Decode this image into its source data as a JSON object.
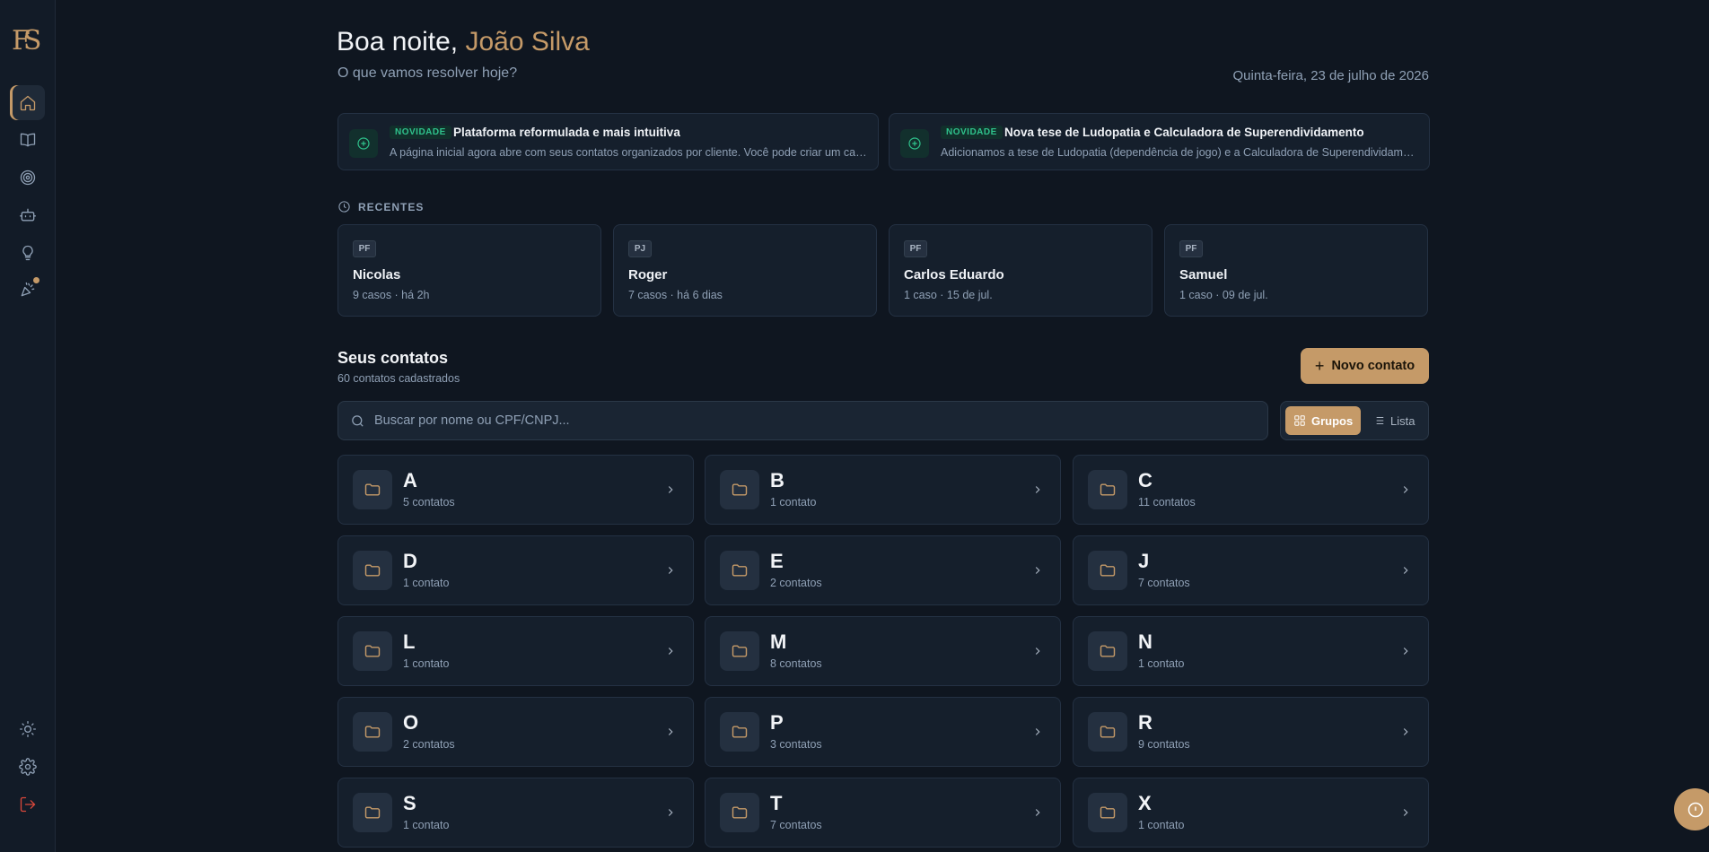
{
  "greeting": {
    "prefix": "Boa noite,",
    "name": "João Silva"
  },
  "subtitle": "O que vamos resolver hoje?",
  "date": "Quinta-feira, 23 de julho de 2026",
  "news": [
    {
      "badge": "NOVIDADE",
      "title": "Plataforma reformulada e mais intuitiva",
      "description": "A página inicial agora abre com seus contatos organizados por cliente. Você pode criar um caso..."
    },
    {
      "badge": "NOVIDADE",
      "title": "Nova tese de Ludopatia e Calculadora de Superendividamento",
      "description": "Adicionamos a tese de Ludopatia (dependência de jogo) e a Calculadora de Superendividamento..."
    }
  ],
  "recents": {
    "label": "RECENTES",
    "items": [
      {
        "type": "PF",
        "name": "Nicolas",
        "meta": "9 casos · há 2h"
      },
      {
        "type": "PJ",
        "name": "Roger",
        "meta": "7 casos · há 6 dias"
      },
      {
        "type": "PF",
        "name": "Carlos Eduardo",
        "meta": "1 caso · 15 de jul."
      },
      {
        "type": "PF",
        "name": "Samuel",
        "meta": "1 caso · 09 de jul."
      }
    ]
  },
  "contacts": {
    "title": "Seus contatos",
    "count": "60 contatos cadastrados",
    "new_button": "Novo contato",
    "search_placeholder": "Buscar por nome ou CPF/CNPJ...",
    "view_groups": "Grupos",
    "view_list": "Lista",
    "groups": [
      {
        "letter": "A",
        "count": "5 contatos"
      },
      {
        "letter": "B",
        "count": "1 contato"
      },
      {
        "letter": "C",
        "count": "11 contatos"
      },
      {
        "letter": "D",
        "count": "1 contato"
      },
      {
        "letter": "E",
        "count": "2 contatos"
      },
      {
        "letter": "J",
        "count": "7 contatos"
      },
      {
        "letter": "L",
        "count": "1 contato"
      },
      {
        "letter": "M",
        "count": "8 contatos"
      },
      {
        "letter": "N",
        "count": "1 contato"
      },
      {
        "letter": "O",
        "count": "2 contatos"
      },
      {
        "letter": "P",
        "count": "3 contatos"
      },
      {
        "letter": "R",
        "count": "9 contatos"
      },
      {
        "letter": "S",
        "count": "1 contato"
      },
      {
        "letter": "T",
        "count": "7 contatos"
      },
      {
        "letter": "X",
        "count": "1 contato"
      }
    ]
  },
  "sidebar": {
    "logo": "FS",
    "items": [
      "home-icon",
      "book-icon",
      "target-icon",
      "bot-icon",
      "lightbulb-icon",
      "party-icon"
    ],
    "bottom": [
      "sun-icon",
      "gear-icon",
      "logout-icon"
    ]
  },
  "colors": {
    "accent": "#c59a68",
    "background": "#0f1620",
    "new_badge": "#2fc28c"
  }
}
